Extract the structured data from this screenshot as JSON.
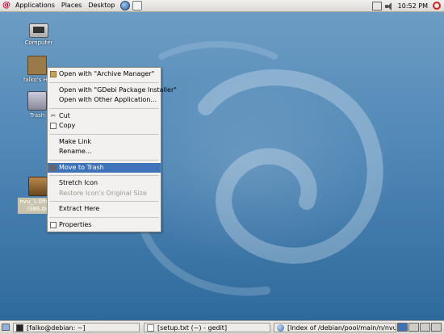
{
  "top_panel": {
    "menus": [
      "Applications",
      "Places",
      "Desktop"
    ],
    "clock": "10:52 PM"
  },
  "desktop": {
    "icons": [
      {
        "label": "Computer"
      },
      {
        "label": "falko's Ho"
      },
      {
        "label": "Trash"
      },
      {
        "label": "nvu_1.0final-",
        "label2": "i386.de"
      }
    ]
  },
  "context_menu": {
    "items": [
      "Open with \"Archive Manager\"",
      "Open with \"GDebi Package Installer\"",
      "Open with Other Application...",
      "Cut",
      "Copy",
      "Make Link",
      "Rename...",
      "Move to Trash",
      "Stretch Icon",
      "Restore Icon's Original Size",
      "Extract Here",
      "Properties"
    ]
  },
  "taskbar": {
    "tasks": [
      "[falko@debian: ~]",
      "[setup.txt (~) - gedit]",
      "[Index of /debian/pool/main/n/nvu - Ice..."
    ]
  }
}
